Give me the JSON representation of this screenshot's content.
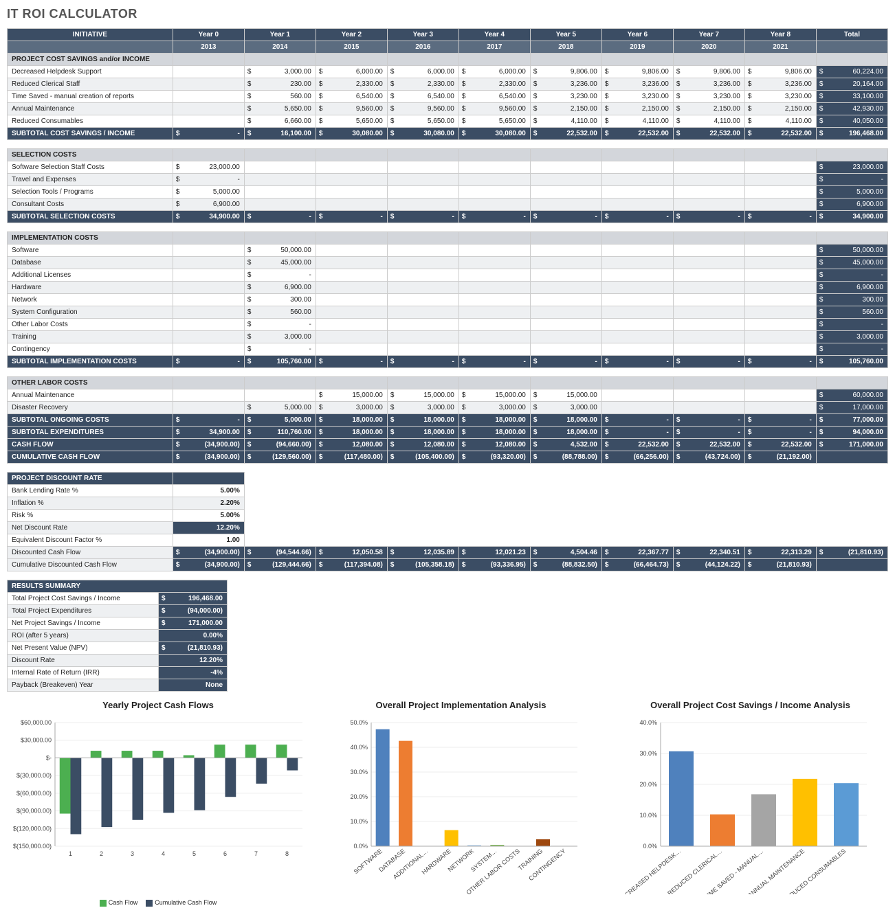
{
  "title": "IT ROI CALCULATOR",
  "years_header": [
    "Year 0",
    "Year 1",
    "Year 2",
    "Year 3",
    "Year 4",
    "Year 5",
    "Year 6",
    "Year 7",
    "Year 8",
    "Total"
  ],
  "years_sub": [
    "2013",
    "2014",
    "2015",
    "2016",
    "2017",
    "2018",
    "2019",
    "2020",
    "2021",
    ""
  ],
  "col0": "INITIATIVE",
  "sections": [
    {
      "name": "PROJECT COST SAVINGS and/or INCOME",
      "rows": [
        {
          "label": "Decreased Helpdesk Support",
          "vals": [
            "",
            "3,000.00",
            "6,000.00",
            "6,000.00",
            "6,000.00",
            "9,806.00",
            "9,806.00",
            "9,806.00",
            "9,806.00",
            "60,224.00"
          ]
        },
        {
          "label": "Reduced Clerical Staff",
          "vals": [
            "",
            "230.00",
            "2,330.00",
            "2,330.00",
            "2,330.00",
            "3,236.00",
            "3,236.00",
            "3,236.00",
            "3,236.00",
            "20,164.00"
          ]
        },
        {
          "label": "Time Saved - manual creation of reports",
          "vals": [
            "",
            "560.00",
            "6,540.00",
            "6,540.00",
            "6,540.00",
            "3,230.00",
            "3,230.00",
            "3,230.00",
            "3,230.00",
            "33,100.00"
          ]
        },
        {
          "label": "Annual Maintenance",
          "vals": [
            "",
            "5,650.00",
            "9,560.00",
            "9,560.00",
            "9,560.00",
            "2,150.00",
            "2,150.00",
            "2,150.00",
            "2,150.00",
            "42,930.00"
          ]
        },
        {
          "label": "Reduced Consumables",
          "vals": [
            "",
            "6,660.00",
            "5,650.00",
            "5,650.00",
            "5,650.00",
            "4,110.00",
            "4,110.00",
            "4,110.00",
            "4,110.00",
            "40,050.00"
          ]
        }
      ],
      "subtotal": {
        "label": "SUBTOTAL COST SAVINGS / INCOME",
        "vals": [
          "-",
          "16,100.00",
          "30,080.00",
          "30,080.00",
          "30,080.00",
          "22,532.00",
          "22,532.00",
          "22,532.00",
          "22,532.00",
          "196,468.00"
        ]
      }
    },
    {
      "name": "SELECTION COSTS",
      "rows": [
        {
          "label": "Software Selection Staff Costs",
          "vals": [
            "23,000.00",
            "",
            "",
            "",
            "",
            "",
            "",
            "",
            "",
            "23,000.00"
          ]
        },
        {
          "label": "Travel and Expenses",
          "vals": [
            "-",
            "",
            "",
            "",
            "",
            "",
            "",
            "",
            "",
            "-"
          ]
        },
        {
          "label": "Selection Tools / Programs",
          "vals": [
            "5,000.00",
            "",
            "",
            "",
            "",
            "",
            "",
            "",
            "",
            "5,000.00"
          ]
        },
        {
          "label": "Consultant Costs",
          "vals": [
            "6,900.00",
            "",
            "",
            "",
            "",
            "",
            "",
            "",
            "",
            "6,900.00"
          ]
        }
      ],
      "subtotal": {
        "label": "SUBTOTAL SELECTION COSTS",
        "vals": [
          "34,900.00",
          "-",
          "-",
          "-",
          "-",
          "-",
          "-",
          "-",
          "-",
          "34,900.00"
        ]
      }
    },
    {
      "name": "IMPLEMENTATION COSTS",
      "rows": [
        {
          "label": "Software",
          "vals": [
            "",
            "50,000.00",
            "",
            "",
            "",
            "",
            "",
            "",
            "",
            "50,000.00"
          ]
        },
        {
          "label": "Database",
          "vals": [
            "",
            "45,000.00",
            "",
            "",
            "",
            "",
            "",
            "",
            "",
            "45,000.00"
          ]
        },
        {
          "label": "Additional Licenses",
          "vals": [
            "",
            "-",
            "",
            "",
            "",
            "",
            "",
            "",
            "",
            "-"
          ]
        },
        {
          "label": "Hardware",
          "vals": [
            "",
            "6,900.00",
            "",
            "",
            "",
            "",
            "",
            "",
            "",
            "6,900.00"
          ]
        },
        {
          "label": "Network",
          "vals": [
            "",
            "300.00",
            "",
            "",
            "",
            "",
            "",
            "",
            "",
            "300.00"
          ]
        },
        {
          "label": "System Configuration",
          "vals": [
            "",
            "560.00",
            "",
            "",
            "",
            "",
            "",
            "",
            "",
            "560.00"
          ]
        },
        {
          "label": "Other Labor Costs",
          "vals": [
            "",
            "-",
            "",
            "",
            "",
            "",
            "",
            "",
            "",
            "-"
          ]
        },
        {
          "label": "Training",
          "vals": [
            "",
            "3,000.00",
            "",
            "",
            "",
            "",
            "",
            "",
            "",
            "3,000.00"
          ]
        },
        {
          "label": "Contingency",
          "vals": [
            "",
            "-",
            "",
            "",
            "",
            "",
            "",
            "",
            "",
            "-"
          ]
        }
      ],
      "subtotal": {
        "label": "SUBTOTAL IMPLEMENTATION COSTS",
        "vals": [
          "-",
          "105,760.00",
          "-",
          "-",
          "-",
          "-",
          "-",
          "-",
          "-",
          "105,760.00"
        ]
      }
    },
    {
      "name": "OTHER LABOR COSTS",
      "rows": [
        {
          "label": "Annual Maintenance",
          "vals": [
            "",
            "",
            "15,000.00",
            "15,000.00",
            "15,000.00",
            "15,000.00",
            "",
            "",
            "",
            "60,000.00"
          ]
        },
        {
          "label": "Disaster Recovery",
          "vals": [
            "",
            "5,000.00",
            "3,000.00",
            "3,000.00",
            "3,000.00",
            "3,000.00",
            "",
            "",
            "",
            "17,000.00"
          ]
        }
      ],
      "subtotals": [
        {
          "label": "SUBTOTAL ONGOING COSTS",
          "vals": [
            "-",
            "5,000.00",
            "18,000.00",
            "18,000.00",
            "18,000.00",
            "18,000.00",
            "-",
            "-",
            "-",
            "77,000.00"
          ]
        },
        {
          "label": "SUBTOTAL EXPENDITURES",
          "vals": [
            "34,900.00",
            "110,760.00",
            "18,000.00",
            "18,000.00",
            "18,000.00",
            "18,000.00",
            "-",
            "-",
            "-",
            "94,000.00"
          ]
        },
        {
          "label": "CASH FLOW",
          "vals": [
            "(34,900.00)",
            "(94,660.00)",
            "12,080.00",
            "12,080.00",
            "12,080.00",
            "4,532.00",
            "22,532.00",
            "22,532.00",
            "22,532.00",
            "171,000.00"
          ]
        },
        {
          "label": "CUMULATIVE CASH FLOW",
          "vals": [
            "(34,900.00)",
            "(129,560.00)",
            "(117,480.00)",
            "(105,400.00)",
            "(93,320.00)",
            "(88,788.00)",
            "(66,256.00)",
            "(43,724.00)",
            "(21,192.00)",
            ""
          ]
        }
      ]
    }
  ],
  "discount": {
    "header": "PROJECT DISCOUNT RATE",
    "rows": [
      {
        "label": "Bank Lending Rate %",
        "val": "5.00%",
        "dark": false
      },
      {
        "label": "Inflation %",
        "val": "2.20%",
        "dark": false
      },
      {
        "label": "Risk %",
        "val": "5.00%",
        "dark": false
      },
      {
        "label": "Net Discount Rate",
        "val": "12.20%",
        "dark": true
      },
      {
        "label": "Equivalent Discount Factor %",
        "val": "1.00",
        "dark": false
      }
    ],
    "dcf": {
      "label": "Discounted Cash Flow",
      "vals": [
        "(34,900.00)",
        "(94,544.66)",
        "12,050.58",
        "12,035.89",
        "12,021.23",
        "4,504.46",
        "22,367.77",
        "22,340.51",
        "22,313.29",
        "(21,810.93)"
      ]
    },
    "cdcf": {
      "label": "Cumulative Discounted Cash Flow",
      "vals": [
        "(34,900.00)",
        "(129,444.66)",
        "(117,394.08)",
        "(105,358.18)",
        "(93,336.95)",
        "(88,832.50)",
        "(66,464.73)",
        "(44,124.22)",
        "(21,810.93)",
        ""
      ]
    }
  },
  "results": {
    "header": "RESULTS SUMMARY",
    "rows": [
      {
        "label": "Total Project Cost Savings / Income",
        "val": "196,468.00",
        "money": true,
        "dark": true
      },
      {
        "label": "Total Project Expenditures",
        "val": "(94,000.00)",
        "money": true,
        "dark": true
      },
      {
        "label": "Net Project Savings / Income",
        "val": "171,000.00",
        "money": true,
        "dark": true
      },
      {
        "label": "ROI (after 5 years)",
        "val": "0.00%",
        "money": false,
        "dark": true
      },
      {
        "label": "Net Present Value (NPV)",
        "val": "(21,810.93)",
        "money": true,
        "dark": true
      },
      {
        "label": "Discount Rate",
        "val": "12.20%",
        "money": false,
        "dark": true
      },
      {
        "label": "Internal Rate of Return (IRR)",
        "val": "-4%",
        "money": false,
        "dark": true
      },
      {
        "label": "Payback (Breakeven) Year",
        "val": "None",
        "money": false,
        "dark": true
      }
    ]
  },
  "chart_data": [
    {
      "type": "bar",
      "title": "Yearly Project Cash Flows",
      "categories": [
        "1",
        "2",
        "3",
        "4",
        "5",
        "6",
        "7",
        "8"
      ],
      "series": [
        {
          "name": "Cash Flow",
          "color": "#4caf50",
          "values": [
            -94660,
            12080,
            12080,
            12080,
            4532,
            22532,
            22532,
            22532
          ]
        },
        {
          "name": "Cumulative Cash Flow",
          "color": "#3b4d64",
          "values": [
            -129560,
            -117480,
            -105400,
            -93320,
            -88788,
            -66256,
            -43724,
            -21192
          ]
        }
      ],
      "ylim": [
        -150000,
        60000
      ],
      "yticks": [
        "$60,000.00",
        "$30,000.00",
        "$-",
        "$(30,000.00)",
        "$(60,000.00)",
        "$(90,000.00)",
        "$(120,000.00)",
        "$(150,000.00)"
      ]
    },
    {
      "type": "bar",
      "title": "Overall Project Implementation Analysis",
      "categories": [
        "SOFTWARE",
        "DATABASE",
        "ADDITIONAL…",
        "HARDWARE",
        "NETWORK",
        "SYSTEM…",
        "OTHER LABOR COSTS",
        "TRAINING",
        "CONTINGENCY"
      ],
      "values": [
        47.3,
        42.6,
        0.0,
        6.5,
        0.3,
        0.5,
        0.0,
        2.8,
        0.0
      ],
      "colors": [
        "#4f81bd",
        "#ed7d31",
        "#a5a5a5",
        "#ffc000",
        "#5b9bd5",
        "#70ad47",
        "#264478",
        "#9e480e",
        "#636363"
      ],
      "ylim": [
        0,
        50
      ],
      "yticks": [
        "50.0%",
        "40.0%",
        "30.0%",
        "20.0%",
        "10.0%",
        "0.0%"
      ]
    },
    {
      "type": "bar",
      "title": "Overall Project Cost Savings / Income Analysis",
      "categories": [
        "DECREASED HELPDESK…",
        "REDUCED CLERICAL…",
        "TIME SAVED - MANUAL…",
        "ANNUAL MAINTENANCE",
        "REDUCED CONSUMABLES"
      ],
      "values": [
        30.7,
        10.3,
        16.8,
        21.8,
        20.4
      ],
      "colors": [
        "#4f81bd",
        "#ed7d31",
        "#a5a5a5",
        "#ffc000",
        "#5b9bd5"
      ],
      "ylim": [
        0,
        40
      ],
      "yticks": [
        "40.0%",
        "30.0%",
        "20.0%",
        "10.0%",
        "0.0%"
      ]
    }
  ]
}
